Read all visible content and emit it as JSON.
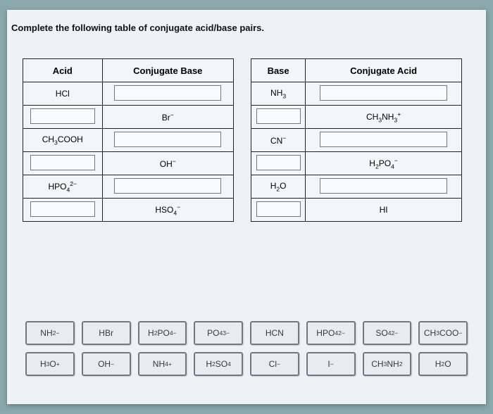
{
  "prompt": "Complete the following table of conjugate acid/base pairs.",
  "table_left": {
    "headers": [
      "Acid",
      "Conjugate Base"
    ],
    "rows": [
      {
        "acid_html": "HCl",
        "base_html": "",
        "acid_filled": true,
        "base_filled": false
      },
      {
        "acid_html": "",
        "base_html": "Br<sup>−</sup>",
        "acid_filled": false,
        "base_filled": true
      },
      {
        "acid_html": "CH<sub>3</sub>COOH",
        "base_html": "",
        "acid_filled": true,
        "base_filled": false
      },
      {
        "acid_html": "",
        "base_html": "OH<sup>−</sup>",
        "acid_filled": false,
        "base_filled": true
      },
      {
        "acid_html": "HPO<sub>4</sub><sup>2−</sup>",
        "base_html": "",
        "acid_filled": true,
        "base_filled": false
      },
      {
        "acid_html": "",
        "base_html": "HSO<sub>4</sub><sup>−</sup>",
        "acid_filled": false,
        "base_filled": true
      }
    ]
  },
  "table_right": {
    "headers": [
      "Base",
      "Conjugate Acid"
    ],
    "rows": [
      {
        "base_html": "NH<sub>3</sub>",
        "acid_html": "",
        "base_filled": true,
        "acid_filled": false
      },
      {
        "base_html": "",
        "acid_html": "CH<sub>3</sub>NH<sub>3</sub><sup>+</sup>",
        "base_filled": false,
        "acid_filled": true
      },
      {
        "base_html": "CN<sup>−</sup>",
        "acid_html": "",
        "base_filled": true,
        "acid_filled": false
      },
      {
        "base_html": "",
        "acid_html": "H<sub>2</sub>PO<sub>4</sub><sup>−</sup>",
        "base_filled": false,
        "acid_filled": true
      },
      {
        "base_html": "H<sub>2</sub>O",
        "acid_html": "",
        "base_filled": true,
        "acid_filled": false
      },
      {
        "base_html": "",
        "acid_html": "HI",
        "base_filled": false,
        "acid_filled": true
      }
    ]
  },
  "answer_bank": [
    [
      "NH<sub>2</sub><sup>−</sup>",
      "HBr",
      "H<sub>2</sub>PO<sub>4</sub><sup>−</sup>",
      "PO<sub>4</sub><sup>3−</sup>",
      "HCN",
      "HPO<sub>4</sub><sup>2−</sup>",
      "SO<sub>4</sub><sup>2−</sup>",
      "CH<sub>3</sub>COO<sup>−</sup>"
    ],
    [
      "H<sub>3</sub>O<sup>+</sup>",
      "OH<sup>−</sup>",
      "NH<sub>4</sub><sup>+</sup>",
      "H<sub>2</sub>SO<sub>4</sub>",
      "Cl<sup>−</sup>",
      "I<sup>−</sup>",
      "CH<sub>3</sub>NH<sub>2</sub>",
      "H<sub>2</sub>O"
    ]
  ]
}
